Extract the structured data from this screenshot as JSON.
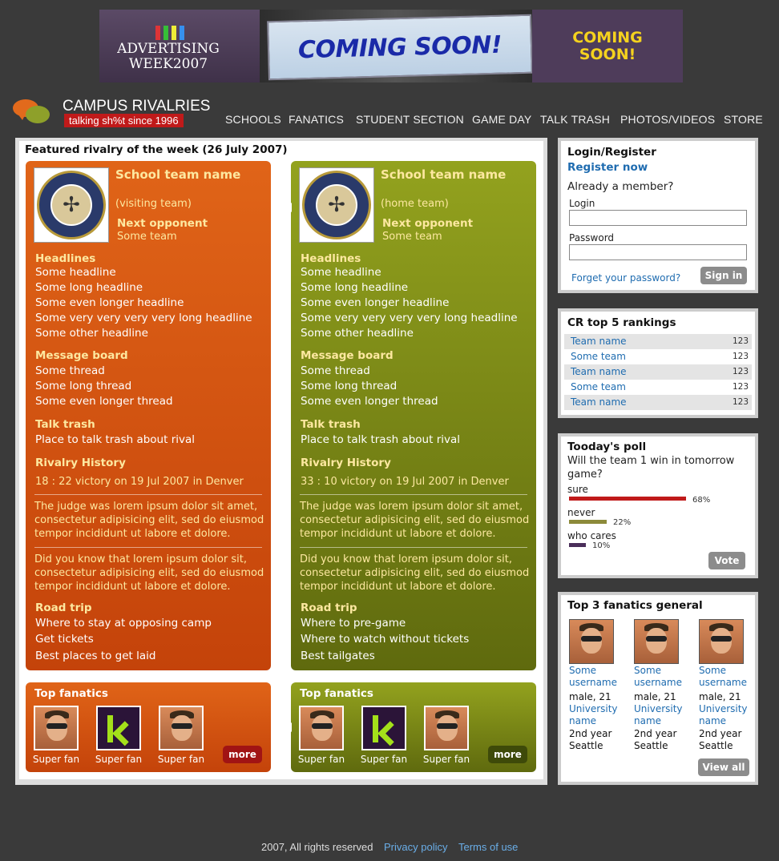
{
  "banner": {
    "left_text": "ADVERTISING WEEK2007",
    "center_text": "COMING SOON!",
    "right_text": "COMING SOON!"
  },
  "header": {
    "brand": "CAMPUS RIVALRIES",
    "tagline": "talking sh%t since 1996",
    "nav": [
      "SCHOOLS",
      "FANATICS",
      "STUDENT SECTION",
      "GAME DAY",
      "TALK TRASH",
      "PHOTOS/VIDEOS",
      "STORE"
    ]
  },
  "featured": {
    "title": "Featured rivalry of the week (26 July 2007)",
    "visiting": {
      "team_name": "School team name",
      "role": "(visiting team)",
      "next_label": "Next opponent",
      "next_value": "Some team",
      "headlines_label": "Headlines",
      "headlines": [
        "Some headline",
        "Some long headline",
        "Some even longer headline",
        "Some very very very very long headline",
        "Some other headline"
      ],
      "board_label": "Message board",
      "threads": [
        "Some thread",
        "Some long thread",
        "Some even longer thread"
      ],
      "trash_label": "Talk trash",
      "trash_item": "Place to talk trash about rival",
      "history_label": "Rivalry History",
      "history_result": "18 : 22 victory on 19 Jul 2007 in Denver",
      "para1": "The judge was lorem ipsum dolor sit amet, consectetur adipisicing elit, sed do eiusmod tempor incididunt ut labore et dolore.",
      "para2": "Did you know that lorem ipsum dolor sit, consectetur adipisicing elit, sed do eiusmod tempor incididunt ut labore et dolore.",
      "road_label": "Road trip",
      "road": [
        "Where to stay at opposing camp",
        "Get tickets",
        "Best places to get laid"
      ],
      "fans_title": "Top fanatics",
      "fans": [
        "Super fan",
        "Super fan",
        "Super fan"
      ],
      "more": "more"
    },
    "home": {
      "team_name": "School team name",
      "role": "(home team)",
      "next_label": "Next opponent",
      "next_value": "Some team",
      "headlines_label": "Headlines",
      "headlines": [
        "Some headline",
        "Some long headline",
        "Some even longer headline",
        "Some very very very very long headline",
        "Some other headline"
      ],
      "board_label": "Message board",
      "threads": [
        "Some thread",
        "Some long thread",
        "Some even longer thread"
      ],
      "trash_label": "Talk trash",
      "trash_item": "Place to talk trash about rival",
      "history_label": "Rivalry History",
      "history_result": "33 : 10 victory on 19 Jul 2007 in Denver",
      "para1": "The judge was lorem ipsum dolor sit amet, consectetur adipisicing elit, sed do eiusmod tempor incididunt ut labore et dolore.",
      "para2": "Did you know that lorem ipsum dolor sit, consectetur adipisicing elit, sed do eiusmod tempor incididunt ut labore et dolore.",
      "road_label": "Road trip",
      "road": [
        "Where to pre-game",
        "Where to watch without tickets",
        "Best tailgates"
      ],
      "fans_title": "Top fanatics",
      "fans": [
        "Super fan",
        "Super fan",
        "Super fan"
      ],
      "more": "more"
    }
  },
  "login": {
    "title": "Login/Register",
    "register": "Register now",
    "member_q": "Already a member?",
    "login_label": "Login",
    "login_value": "",
    "password_label": "Password",
    "password_value": "",
    "forgot": "Forget your password?",
    "signin": "Sign in"
  },
  "rankings": {
    "title": "CR top 5 rankings",
    "rows": [
      {
        "name": "Team name",
        "score": "123"
      },
      {
        "name": "Some team",
        "score": "123"
      },
      {
        "name": "Team name",
        "score": "123"
      },
      {
        "name": "Some team",
        "score": "123"
      },
      {
        "name": "Team name",
        "score": "123"
      }
    ]
  },
  "poll": {
    "title": "Tooday's poll",
    "question": "Will the team 1 win in tomorrow game?",
    "options": [
      {
        "label": "sure",
        "percent": 68,
        "text": "68%",
        "color": "#c01a1a"
      },
      {
        "label": "never",
        "percent": 22,
        "text": "22%",
        "color": "#8c8a3a"
      },
      {
        "label": "who cares",
        "percent": 10,
        "text": "10%",
        "color": "#4a2e5a"
      }
    ],
    "vote": "Vote"
  },
  "top_fanatics": {
    "title": "Top 3 fanatics general",
    "fans": [
      {
        "username": "Some username",
        "info": "male, 21",
        "university": "University name",
        "year": "2nd year",
        "city": "Seattle"
      },
      {
        "username": "Some username",
        "info": "male, 21",
        "university": "University name",
        "year": "2nd year",
        "city": "Seattle"
      },
      {
        "username": "Some username",
        "info": "male, 21",
        "university": "University name",
        "year": "2nd year",
        "city": "Seattle"
      }
    ],
    "view_all": "View all"
  },
  "footer": {
    "copyright": "2007, All rights reserved",
    "privacy": "Privacy policy",
    "terms": "Terms of use"
  },
  "colors": {
    "orange": "#e06418",
    "green": "#93a21e",
    "link": "#1f6cb0",
    "background": "#3a3a3a"
  }
}
